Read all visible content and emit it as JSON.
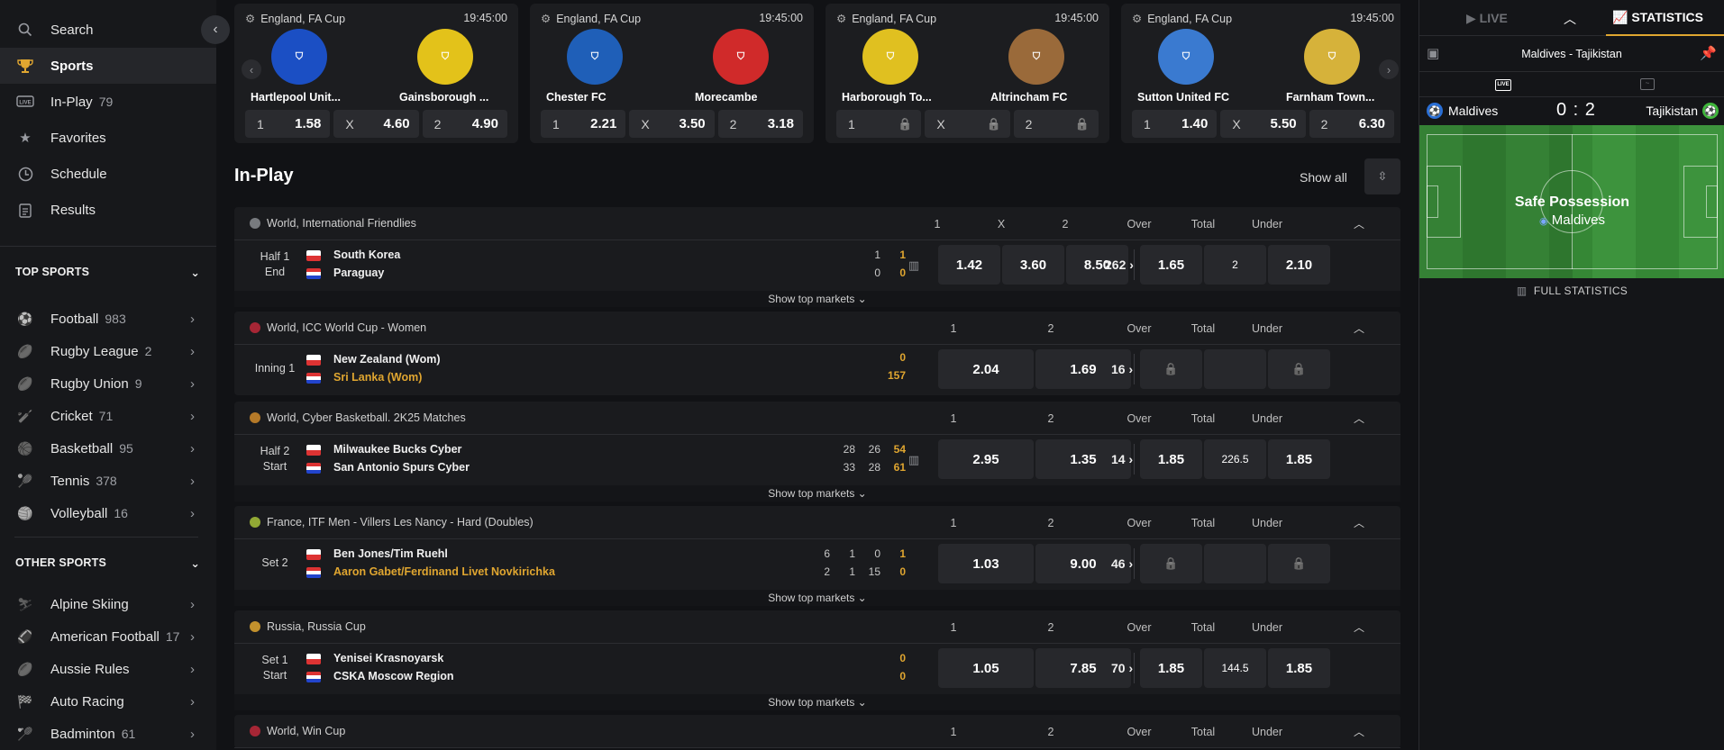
{
  "sidebar": {
    "nav": [
      {
        "label": "Search",
        "icon": "search-icon"
      },
      {
        "label": "Sports",
        "icon": "trophy-icon"
      },
      {
        "label": "In-Play",
        "count": "79",
        "icon": "live-icon"
      },
      {
        "label": "Favorites",
        "icon": "star-icon"
      },
      {
        "label": "Schedule",
        "icon": "clock-icon"
      },
      {
        "label": "Results",
        "icon": "clipboard-icon"
      }
    ],
    "top_sports_title": "TOP SPORTS",
    "top_sports": [
      {
        "label": "Football",
        "count": "983",
        "icon": "football-icon"
      },
      {
        "label": "Rugby League",
        "count": "2",
        "icon": "rugby-icon"
      },
      {
        "label": "Rugby Union",
        "count": "9",
        "icon": "rugby-icon"
      },
      {
        "label": "Cricket",
        "count": "71",
        "icon": "cricket-icon"
      },
      {
        "label": "Basketball",
        "count": "95",
        "icon": "basketball-icon"
      },
      {
        "label": "Tennis",
        "count": "378",
        "icon": "tennis-icon"
      },
      {
        "label": "Volleyball",
        "count": "16",
        "icon": "volleyball-icon"
      }
    ],
    "other_sports_title": "OTHER SPORTS",
    "other_sports": [
      {
        "label": "Alpine Skiing",
        "count": "",
        "icon": "skiing-icon"
      },
      {
        "label": "American Football",
        "count": "17",
        "icon": "american-football-icon"
      },
      {
        "label": "Aussie Rules",
        "count": "",
        "icon": "aussie-rules-icon"
      },
      {
        "label": "Auto Racing",
        "count": "",
        "icon": "racing-flag-icon"
      },
      {
        "label": "Badminton",
        "count": "61",
        "icon": "badminton-icon"
      }
    ]
  },
  "featured": [
    {
      "league": "England, FA Cup",
      "time": "19:45:00",
      "home": "Hartlepool Unit...",
      "away": "Gainsborough ...",
      "home_color": "#1b4fc4",
      "away_color": "#e3c21a",
      "odds": [
        {
          "label": "1",
          "value": "1.58"
        },
        {
          "label": "X",
          "value": "4.60"
        },
        {
          "label": "2",
          "value": "4.90"
        }
      ]
    },
    {
      "league": "England, FA Cup",
      "time": "19:45:00",
      "home": "Chester FC",
      "away": "Morecambe",
      "home_color": "#1f5fb8",
      "away_color": "#d02a2a",
      "odds": [
        {
          "label": "1",
          "value": "2.21"
        },
        {
          "label": "X",
          "value": "3.50"
        },
        {
          "label": "2",
          "value": "3.18"
        }
      ]
    },
    {
      "league": "England, FA Cup",
      "time": "19:45:00",
      "home": "Harborough To...",
      "away": "Altrincham FC",
      "home_color": "#e0c020",
      "away_color": "#9a6a3a",
      "odds": [
        {
          "label": "1",
          "value": ""
        },
        {
          "label": "X",
          "value": ""
        },
        {
          "label": "2",
          "value": ""
        }
      ]
    },
    {
      "league": "England, FA Cup",
      "time": "19:45:00",
      "home": "Sutton United FC",
      "away": "Farnham Town...",
      "home_color": "#3a7ad0",
      "away_color": "#d6b23a",
      "odds": [
        {
          "label": "1",
          "value": "1.40"
        },
        {
          "label": "X",
          "value": "5.50"
        },
        {
          "label": "2",
          "value": "6.30"
        }
      ]
    }
  ],
  "inplay": {
    "title": "In-Play",
    "show_all": "Show all",
    "show_top_markets": "Show top markets",
    "col_headers": {
      "one": "1",
      "x": "X",
      "two": "2",
      "over": "Over",
      "total": "Total",
      "under": "Under"
    },
    "leagues": [
      {
        "name": "World, International Friendlies",
        "icon_color": "#8a8c91",
        "period": "Half 1",
        "sub": "End",
        "home": "South Korea",
        "away": "Paraguay",
        "home_scores": [
          "1",
          "1"
        ],
        "away_scores": [
          "0",
          "0"
        ],
        "odds": [
          "1.42",
          "3.60",
          "8.50"
        ],
        "over": "1.65",
        "total": "2",
        "under": "2.10",
        "more": "262"
      },
      {
        "name": "World, ICC World Cup - Women",
        "icon_color": "#c0283a",
        "period": "Inning 1",
        "sub": "",
        "home": "New Zealand (Wom)",
        "away": "Sri Lanka (Wom)",
        "home_scores": [
          "0"
        ],
        "away_scores": [
          "157"
        ],
        "odds": [
          "2.04",
          "1.69"
        ],
        "over": "",
        "total": "",
        "under": "",
        "more": "16"
      },
      {
        "name": "World, Cyber Basketball. 2K25 Matches",
        "icon_color": "#d08a2a",
        "period": "Half 2",
        "sub": "Start",
        "home": "Milwaukee Bucks Cyber",
        "away": "San Antonio Spurs Cyber",
        "home_scores": [
          "28",
          "26",
          "54"
        ],
        "away_scores": [
          "33",
          "28",
          "61"
        ],
        "odds": [
          "2.95",
          "1.35"
        ],
        "over": "1.85",
        "total": "226.5",
        "under": "1.85",
        "more": "14"
      },
      {
        "name": "France, ITF Men - Villers Les Nancy - Hard (Doubles)",
        "icon_color": "#a8c23a",
        "period": "Set 2",
        "sub": "",
        "home": "Ben Jones/Tim Ruehl",
        "away": "Aaron Gabet/Ferdinand Livet Novkirichka",
        "home_scores": [
          "6",
          "1",
          "0",
          "1"
        ],
        "away_scores": [
          "2",
          "1",
          "15",
          "0"
        ],
        "odds": [
          "1.03",
          "9.00"
        ],
        "over": "",
        "total": "",
        "under": "",
        "more": "46"
      },
      {
        "name": "Russia, Russia Cup",
        "icon_color": "#e0a630",
        "period": "Set 1",
        "sub": "Start",
        "home": "Yenisei Krasnoyarsk",
        "away": "CSKA Moscow Region",
        "home_scores": [
          "0"
        ],
        "away_scores": [
          "0"
        ],
        "odds": [
          "1.05",
          "7.85"
        ],
        "over": "1.85",
        "total": "144.5",
        "under": "1.85",
        "more": "70"
      },
      {
        "name": "World, Win Cup",
        "icon_color": "#c0283a"
      }
    ]
  },
  "right_panel": {
    "live_tab": "LIVE",
    "stats_tab": "STATISTICS",
    "match": "Maldives - Tajikistan",
    "home": "Maldives",
    "away": "Tajikistan",
    "score": "0 : 2",
    "possession_title": "Safe Possession",
    "possession_team": "Maldives",
    "full_stats": "FULL STATISTICS"
  }
}
